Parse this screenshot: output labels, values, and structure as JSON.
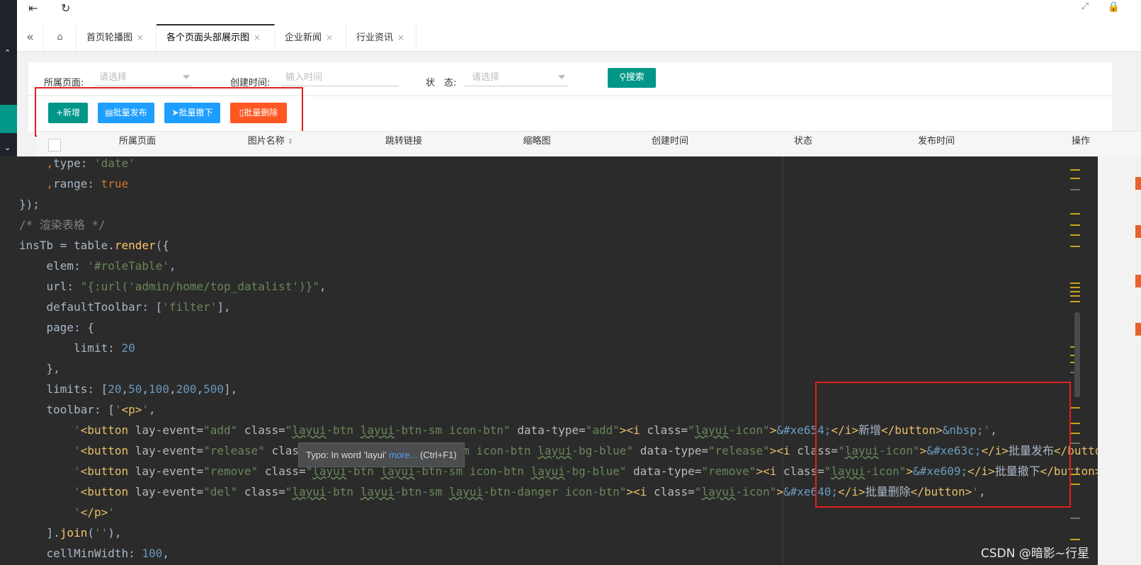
{
  "header": {
    "menu_icon": "outdent-icon",
    "refresh_icon": "refresh-icon",
    "fullscreen_icon": "fullscreen-icon",
    "lock_icon": "lock-icon"
  },
  "tabs": [
    {
      "label": "首页轮播图",
      "close": "×"
    },
    {
      "label": "各个页面头部展示图",
      "close": "×",
      "active": true
    },
    {
      "label": "企业新闻",
      "close": "×"
    },
    {
      "label": "行业资讯",
      "close": "×"
    }
  ],
  "search": {
    "page_label": "所属页面:",
    "page_placeholder": "请选择",
    "time_label": "创建时间:",
    "time_placeholder": "输入时间",
    "status_label": "状　态:",
    "status_placeholder": "请选择",
    "search_button": "搜索"
  },
  "toolbar": {
    "add": "新增",
    "release": "批量发布",
    "remove": "批量撤下",
    "del": "批量删除",
    "colors": {
      "add": "#009688",
      "release": "#1e9fff",
      "remove": "#1e9fff",
      "del": "#ff5722"
    }
  },
  "table": {
    "columns": [
      "所属页面",
      "图片名称",
      "跳转链接",
      "缩略图",
      "创建时间",
      "状态",
      "发布时间",
      "操作"
    ]
  },
  "editor": {
    "tooltip_text": "Typo: In word 'layui'",
    "tooltip_link": "more...",
    "tooltip_shortcut": "(Ctrl+F1)"
  },
  "watermark": "CSDN @暗影~行星"
}
